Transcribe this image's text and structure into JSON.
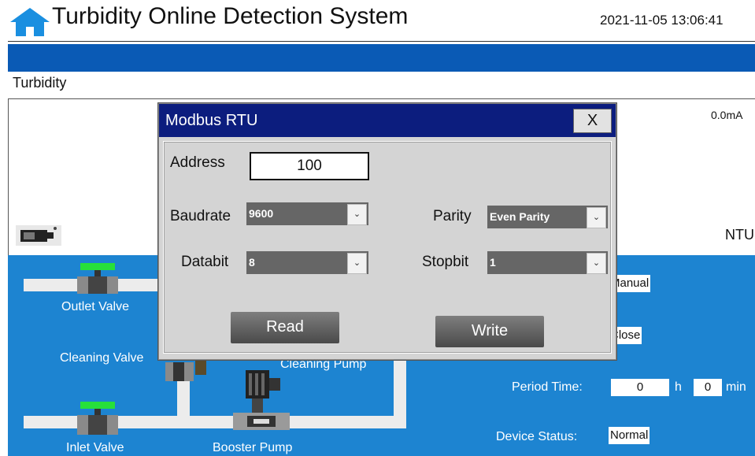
{
  "header": {
    "title": "Turbidity Online Detection System",
    "datetime": "2021-11-05 13:06:41",
    "home_icon": "home-icon"
  },
  "section": {
    "label": "Turbidity"
  },
  "readings": {
    "current": "0.0mA",
    "unit": "NTU"
  },
  "process": {
    "outlet_valve": "Outlet Valve",
    "cleaning_valve": "Cleaning Valve",
    "cleaning_pump": "Cleaning Pump",
    "inlet_valve": "Inlet Valve",
    "booster_pump": "Booster Pump",
    "mode_value": "Manual",
    "state_value": "Close",
    "period_time_label": "Period Time:",
    "period_hours": "0",
    "hours_unit": "h",
    "period_minutes": "0",
    "minutes_unit": "min",
    "device_status_label": "Device Status:",
    "device_status_value": "Normal",
    "colors": {
      "valve_open": "#27e03a",
      "panel_blue": "#1d84d1",
      "dialog_title": "#0c1d7e"
    }
  },
  "dialog": {
    "title": "Modbus RTU",
    "close_label": "X",
    "address_label": "Address",
    "address_value": "100",
    "baudrate_label": "Baudrate",
    "baudrate_value": "9600",
    "parity_label": "Parity",
    "parity_value": "Even Parity",
    "databit_label": "Databit",
    "databit_value": "8",
    "stopbit_label": "Stopbit",
    "stopbit_value": "1",
    "dropdown_arrow": "⌄",
    "read_label": "Read",
    "write_label": "Write"
  }
}
